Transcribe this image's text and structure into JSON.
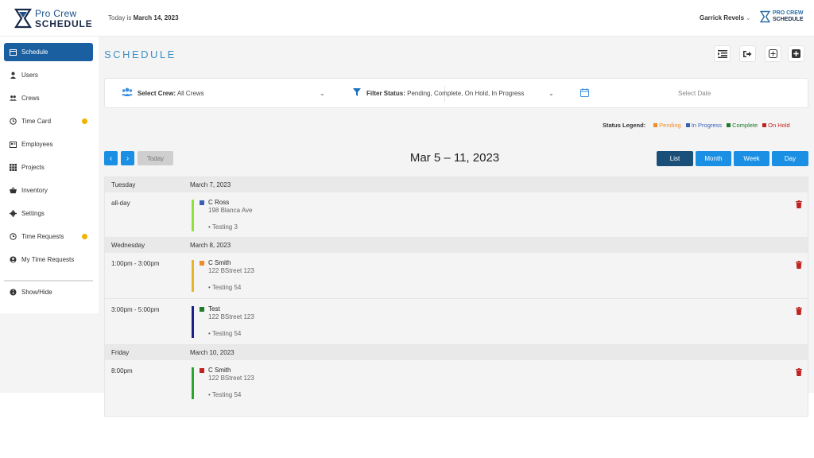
{
  "header": {
    "logo_line1": "Pro Crew",
    "logo_line2": "SCHEDULE",
    "today_prefix": "Today is",
    "today_date": "March 14, 2023",
    "user_name": "Garrick Revels",
    "brand_line1": "PRO CREW",
    "brand_line2": "SCHEDULE"
  },
  "sidebar": {
    "items": [
      {
        "label": "Schedule",
        "icon": "calendar-icon",
        "active": true,
        "badge": false
      },
      {
        "label": "Users",
        "icon": "user-icon",
        "active": false,
        "badge": false
      },
      {
        "label": "Crews",
        "icon": "users-icon",
        "active": false,
        "badge": false
      },
      {
        "label": "Time Card",
        "icon": "clock-icon",
        "active": false,
        "badge": true
      },
      {
        "label": "Employees",
        "icon": "id-card-icon",
        "active": false,
        "badge": false
      },
      {
        "label": "Projects",
        "icon": "grid-icon",
        "active": false,
        "badge": false
      },
      {
        "label": "Inventory",
        "icon": "basket-icon",
        "active": false,
        "badge": false
      },
      {
        "label": "Settings",
        "icon": "gear-icon",
        "active": false,
        "badge": false
      },
      {
        "label": "Time Requests",
        "icon": "clock-icon",
        "active": false,
        "badge": true
      },
      {
        "label": "My Time Requests",
        "icon": "user-circle-icon",
        "active": false,
        "badge": false
      }
    ],
    "show_hide": "Show/Hide"
  },
  "main": {
    "title": "SCHEDULE",
    "filters": {
      "crew_label": "Select Crew:",
      "crew_value": "All Crews",
      "status_label": "Filter Status:",
      "status_value": "Pending, Complete, On Hold, In Progress",
      "date_placeholder": "Select Date"
    },
    "legend": {
      "label": "Status Legend:",
      "items": [
        {
          "label": "Pending",
          "color": "#f08c2a"
        },
        {
          "label": "In Progress",
          "color": "#3b5fb6"
        },
        {
          "label": "Complete",
          "color": "#1f7a2a"
        },
        {
          "label": "On Hold",
          "color": "#c0231f"
        }
      ]
    },
    "toolbar": {
      "today": "Today",
      "range": "Mar 5 – 11, 2023",
      "views": [
        "List",
        "Month",
        "Week",
        "Day"
      ],
      "active_view": "List"
    },
    "days": [
      {
        "day": "Tuesday",
        "date": "March 7, 2023",
        "events": [
          {
            "time": "all-day",
            "name": "C Ross",
            "address": "198 Blanca Ave",
            "note": "Testing 3",
            "bar_color": "#8fe03a",
            "status_color": "#3b5fb6"
          }
        ]
      },
      {
        "day": "Wednesday",
        "date": "March 8, 2023",
        "events": [
          {
            "time": "1:00pm - 3:00pm",
            "name": "C Smith",
            "address": "122 BStreet 123",
            "note": "Testing 54",
            "bar_color": "#e8b52a",
            "status_color": "#f08c2a"
          },
          {
            "time": "3:00pm - 5:00pm",
            "name": "Test",
            "address": "122 BStreet 123",
            "note": "Testing 54",
            "bar_color": "#1a1f8c",
            "status_color": "#1f7a2a"
          }
        ]
      },
      {
        "day": "Friday",
        "date": "March 10, 2023",
        "events": [
          {
            "time": "8:00pm",
            "name": "C Smith",
            "address": "122 BStreet 123",
            "note": "Testing 54",
            "bar_color": "#2aa62a",
            "status_color": "#c0231f"
          }
        ]
      }
    ]
  }
}
